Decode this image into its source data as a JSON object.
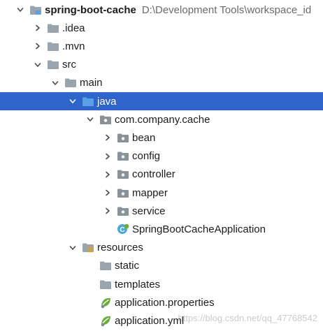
{
  "colors": {
    "selection": "#2f65ca",
    "folder": "#9aa4ad",
    "folder_blue": "#5aa0e6",
    "package": "#8a9298",
    "spring": "#6aad3d",
    "java_class": "#49a8d8"
  },
  "tree": [
    {
      "label": "spring-boot-cache",
      "path": "D:\\Development Tools\\workspace_id",
      "depth": 0,
      "arrow": "down",
      "icon": "module-folder-icon",
      "bold": true
    },
    {
      "label": ".idea",
      "depth": 1,
      "arrow": "right",
      "icon": "folder-icon"
    },
    {
      "label": ".mvn",
      "depth": 1,
      "arrow": "right",
      "icon": "folder-icon"
    },
    {
      "label": "src",
      "depth": 1,
      "arrow": "down",
      "icon": "folder-icon"
    },
    {
      "label": "main",
      "depth": 2,
      "arrow": "down",
      "icon": "folder-icon"
    },
    {
      "label": "java",
      "depth": 3,
      "arrow": "down",
      "icon": "source-folder-icon",
      "selected": true
    },
    {
      "label": "com.company.cache",
      "depth": 4,
      "arrow": "down",
      "icon": "package-icon"
    },
    {
      "label": "bean",
      "depth": 5,
      "arrow": "right",
      "icon": "package-icon"
    },
    {
      "label": "config",
      "depth": 5,
      "arrow": "right",
      "icon": "package-icon"
    },
    {
      "label": "controller",
      "depth": 5,
      "arrow": "right",
      "icon": "package-icon"
    },
    {
      "label": "mapper",
      "depth": 5,
      "arrow": "right",
      "icon": "package-icon"
    },
    {
      "label": "service",
      "depth": 5,
      "arrow": "right",
      "icon": "package-icon"
    },
    {
      "label": "SpringBootCacheApplication",
      "depth": 5,
      "arrow": "none",
      "icon": "spring-boot-class-icon"
    },
    {
      "label": "resources",
      "depth": 3,
      "arrow": "down",
      "icon": "resources-folder-icon"
    },
    {
      "label": "static",
      "depth": 4,
      "arrow": "none",
      "icon": "folder-icon"
    },
    {
      "label": "templates",
      "depth": 4,
      "arrow": "none",
      "icon": "folder-icon"
    },
    {
      "label": "application.properties",
      "depth": 4,
      "arrow": "none",
      "icon": "spring-config-icon"
    },
    {
      "label": "application.yml",
      "depth": 4,
      "arrow": "none",
      "icon": "spring-config-icon"
    }
  ],
  "watermark": "https://blog.csdn.net/qq_47768542"
}
